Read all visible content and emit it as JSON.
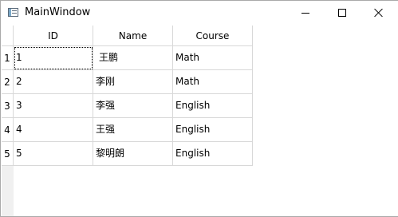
{
  "window": {
    "title": "MainWindow",
    "icons": {
      "app": "window-icon",
      "minimize": "minimize-icon",
      "maximize": "maximize-icon",
      "close": "close-icon"
    }
  },
  "table": {
    "columns": [
      "ID",
      "Name",
      "Course"
    ],
    "row_headers": [
      "1",
      "2",
      "3",
      "4",
      "5"
    ],
    "rows": [
      [
        "1",
        "王鹏",
        "Math"
      ],
      [
        "2",
        "李刚",
        "Math"
      ],
      [
        "3",
        "李强",
        "English"
      ],
      [
        "4",
        "王强",
        "English"
      ],
      [
        "5",
        "黎明朗",
        "English"
      ]
    ],
    "focused_cell": {
      "row": 0,
      "col": 0
    }
  }
}
